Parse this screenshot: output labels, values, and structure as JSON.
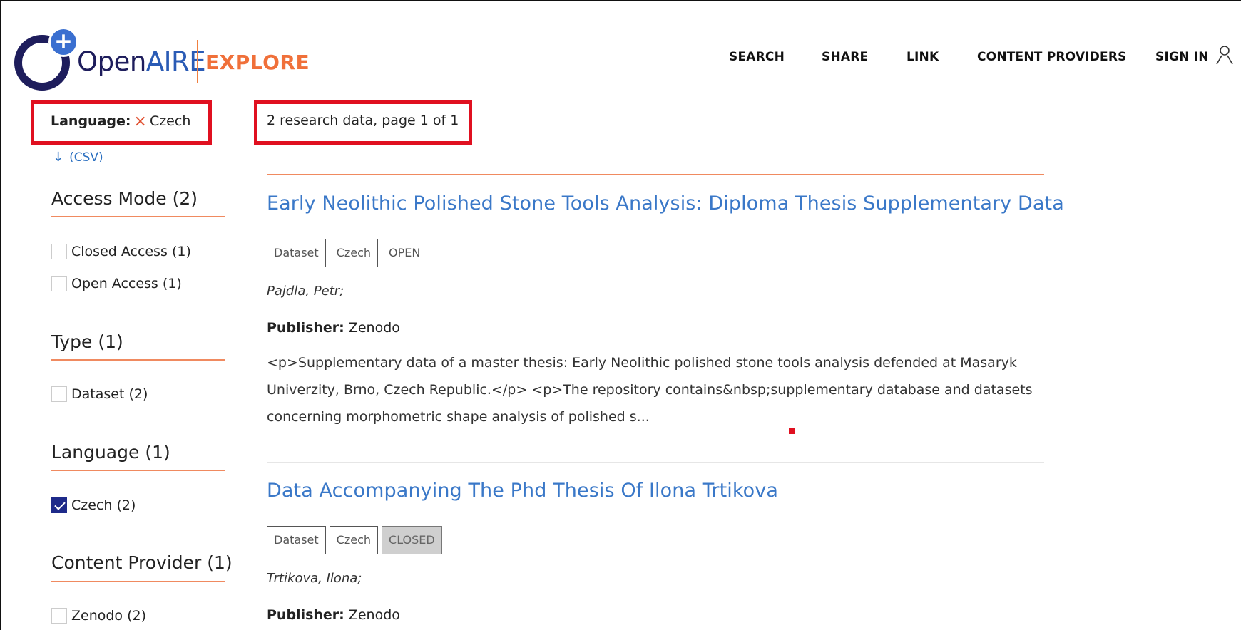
{
  "header": {
    "logo": {
      "open": "Open",
      "aire": "AIRE",
      "explore": "EXPLORE",
      "plus": "+"
    },
    "nav": {
      "search": "SEARCH",
      "share": "SHARE",
      "link": "LINK",
      "content_providers": "CONTENT PROVIDERS",
      "sign_in": "SIGN IN"
    }
  },
  "active_filter": {
    "label": "Language:",
    "remove_icon": "×",
    "value": "Czech"
  },
  "results_summary": "2 research data, page 1 of 1",
  "download": {
    "arrow": "↓",
    "label": "(CSV)"
  },
  "facets": [
    {
      "title": "Access Mode (2)",
      "items": [
        {
          "label": "Closed Access (1)",
          "checked": false
        },
        {
          "label": "Open Access (1)",
          "checked": false
        }
      ]
    },
    {
      "title": "Type (1)",
      "items": [
        {
          "label": "Dataset (2)",
          "checked": false
        }
      ]
    },
    {
      "title": "Language (1)",
      "items": [
        {
          "label": "Czech (2)",
          "checked": true
        }
      ]
    },
    {
      "title": "Content Provider (1)",
      "items": [
        {
          "label": "Zenodo (2)",
          "checked": false
        }
      ]
    }
  ],
  "results": [
    {
      "title": "Early Neolithic Polished Stone Tools Analysis: Diploma Thesis Supplementary Data",
      "badges": [
        "Dataset",
        "Czech",
        "OPEN"
      ],
      "authors": "Pajdla, Petr;",
      "publisher_label": "Publisher:",
      "publisher": "Zenodo",
      "description_lines": [
        "<p>Supplementary data of a master thesis: Early Neolithic polished stone tools analysis defended at Masaryk",
        "Univerzity, Brno, Czech Republic.</p> <p>The repository contains&nbsp;supplementary database and datasets",
        "concerning morphometric shape analysis of polished s..."
      ]
    },
    {
      "title": "Data Accompanying The Phd Thesis Of Ilona Trtikova",
      "badges": [
        "Dataset",
        "Czech",
        "CLOSED"
      ],
      "authors": "Trtikova, Ilona;",
      "publisher_label": "Publisher:",
      "publisher": "Zenodo"
    }
  ],
  "colors": {
    "brand_navy": "#1e1d5c",
    "brand_blue": "#3a6fd0",
    "accent_orange": "#f0703a",
    "link_blue": "#3a78c8",
    "highlight_red": "#e01020"
  }
}
